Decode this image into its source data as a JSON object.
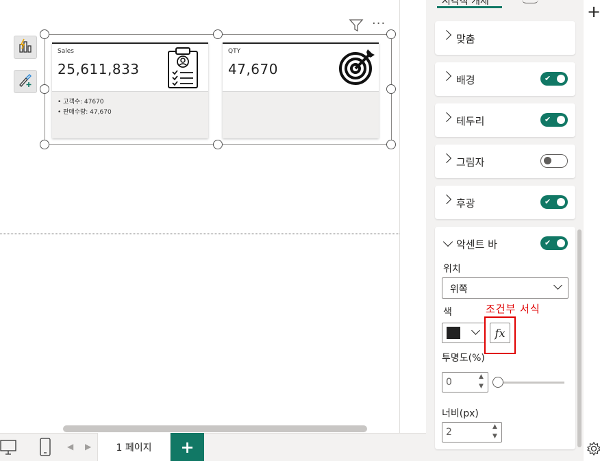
{
  "cards": [
    {
      "label": "Sales",
      "value": "25,611,833",
      "notes": [
        "• 고객수: 47670",
        "• 판매수량: 47,670"
      ]
    },
    {
      "label": "QTY",
      "value": "47,670"
    }
  ],
  "pages": {
    "tab_label": "1 페이지",
    "add_label": "+"
  },
  "pane": {
    "top_tab": "시각적 개체",
    "sections": [
      {
        "title": "맞춤",
        "toggle": null
      },
      {
        "title": "배경",
        "toggle": "on"
      },
      {
        "title": "테두리",
        "toggle": "on"
      },
      {
        "title": "그림자",
        "toggle": "off"
      },
      {
        "title": "후광",
        "toggle": "on"
      }
    ],
    "accent": {
      "title": "악센트 바",
      "position_label": "위치",
      "position_value": "위쪽",
      "color_label": "색",
      "color_swatch": "#222222",
      "fx_label": "fx",
      "opacity_label": "투명도(%)",
      "opacity_value": "0",
      "opacity_level": 0,
      "width_label": "너비(px)",
      "width_value": "2"
    }
  },
  "annotation": {
    "text": "조건부 서식",
    "color": "#e00000"
  },
  "colors": {
    "accent": "#117865",
    "pane_bg": "#f3f2f1"
  }
}
